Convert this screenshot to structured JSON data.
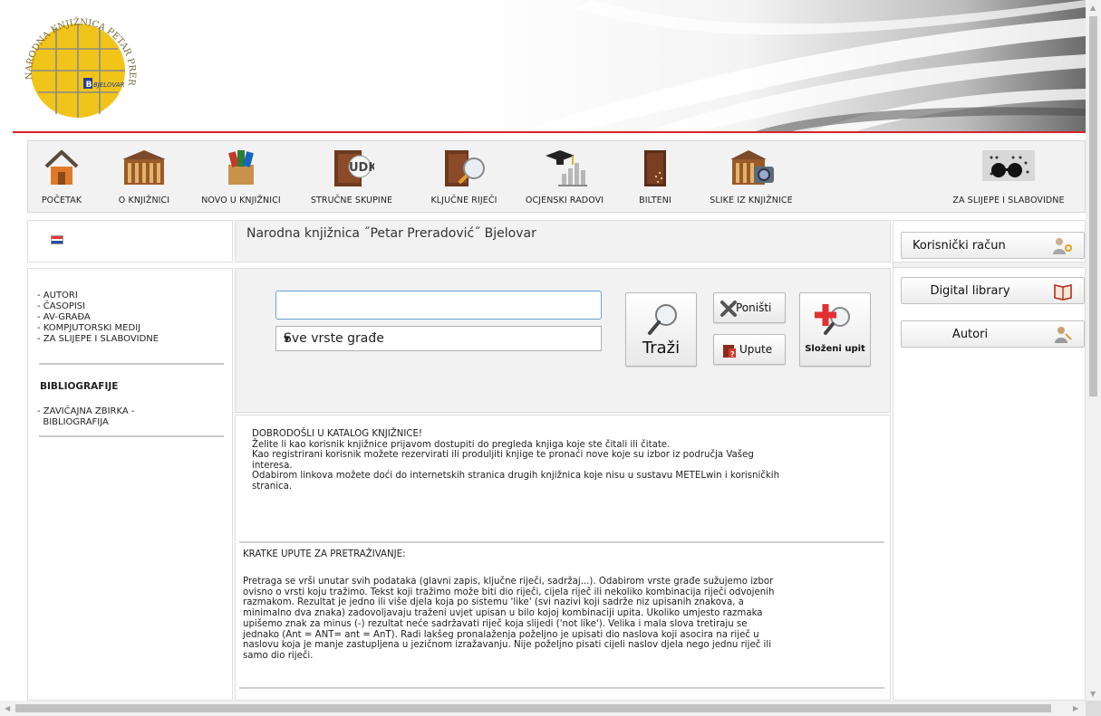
{
  "colors": {
    "accent_red": "#d8232a",
    "panel_bg": "#f2f2f2",
    "input_border": "#6aa2d8",
    "logo_yellow": "#f0c419"
  },
  "logo": {
    "arc_text": "NARODNA KNJIŽNICA PETAR PRERADOVIĆ",
    "city_text": "BJELOVAR"
  },
  "nav": {
    "items": [
      {
        "label": "POČETAK",
        "icon": "home-icon"
      },
      {
        "label": "O KNJIŽNICI",
        "icon": "library-building-icon"
      },
      {
        "label": "NOVO U KNJIŽNICI",
        "icon": "new-books-box-icon"
      },
      {
        "label": "STRUČNE SKUPINE",
        "icon": "udk-book-icon"
      },
      {
        "label": "KLJUČNE RIJEČI",
        "icon": "book-magnifier-icon"
      },
      {
        "label": "OCJENSKI RADOVI",
        "icon": "graduation-cap-chart-icon"
      },
      {
        "label": "BILTENI",
        "icon": "bulletin-book-icon"
      },
      {
        "label": "SLIKE IZ KNJIŽNICE",
        "icon": "building-camera-icon"
      },
      {
        "label": "ZA SLIJEPE I SLABOVIDNE",
        "icon": "braille-glasses-icon"
      }
    ]
  },
  "left_menu": {
    "items": [
      "- AUTORI",
      "- ČASOPISI",
      "- AV-GRAĐA",
      "- KOMPJUTORSKI MEDIJ",
      "- ZA SLIJEPE I SLABOVIDNE"
    ],
    "section_title": "BIBLIOGRAFIJE",
    "section_items": [
      "- ZAVIČAJNA ZBIRKA -",
      "  BIBLIOGRAFIJA"
    ]
  },
  "header": {
    "title": "Narodna knjižnica ˝Petar Preradović˝ Bjelovar"
  },
  "search": {
    "value": "",
    "placeholder": "",
    "type_selected": "Sve vrste građe",
    "search_label": "Traži",
    "reset_label": "Poništi",
    "help_label": "Upute",
    "advanced_label": "Složeni upit"
  },
  "welcome": {
    "lines": [
      "DOBRODOŠLI U KATALOG KNJIŽNICE!",
      "Želite li kao korisnik knjižnice prijavom dostupiti do pregleda knjiga koje ste čitali ili čitate.",
      "Kao registrirani korisnik možete rezervirati ili produljiti knjige te pronaći nove koje su izbor iz područja Vašeg",
      "interesa.",
      "Odabirom linkova možete doći do internetskih stranica drugih knjižnica koje nisu u sustavu METELwin i korisničkih",
      "stranica."
    ]
  },
  "instructions": {
    "title": "KRATKE UPUTE ZA PRETRAŽIVANJE:",
    "lines": [
      "Pretraga se vrši unutar svih podataka (glavni zapis, ključne riječi, sadržaj...). Odabirom vrste građe sužujemo izbor",
      "ovisno o vrsti koju tražimo. Tekst koji tražimo može biti dio riječi, cijela riječ ili nekoliko kombinacija riječi odvojenih",
      "razmakom. Rezultat je jedno ili više djela koja po sistemu 'like' (svi nazivi koji sadrže niz upisanih znakova, a",
      "minimalno dva znaka) zadovoljavaju traženi uvjet upisan u bilo kojoj kombinaciji upita. Ukoliko umjesto razmaka",
      "upišemo znak za minus (-) rezultat neće sadržavati riječ koja slijedi ('not like'). Velika i mala slova tretiraju se",
      "jednako (Ant = ANT= ant = AnT). Radi lakšeg pronalaženja poželjno je upisati dio naslova koji asocira na riječ u",
      "naslovu koja je manje zastupljena u jezičnom izražavanju. Nije poželjno pisati cijeli naslov djela nego jednu riječ ili",
      "samo dio riječi."
    ]
  },
  "right_panel": {
    "account_label": "Korisnički račun",
    "digital_library_label": "Digital library",
    "authors_label": "Autori"
  }
}
